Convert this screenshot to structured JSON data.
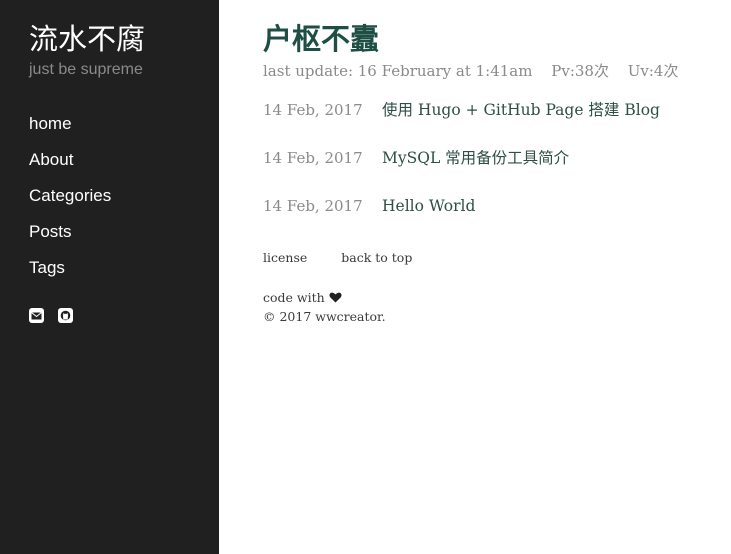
{
  "sidebar": {
    "title": "流水不腐",
    "subtitle": "just be supreme",
    "nav": [
      {
        "label": "home"
      },
      {
        "label": "About"
      },
      {
        "label": "Categories"
      },
      {
        "label": "Posts"
      },
      {
        "label": "Tags"
      }
    ],
    "social": [
      {
        "icon": "email-icon"
      },
      {
        "icon": "github-icon"
      }
    ]
  },
  "main": {
    "title": "户枢不蠹",
    "meta": {
      "last_update": "last update: 16 February at 1:41am",
      "pv": "Pv:38次",
      "uv": "Uv:4次"
    },
    "posts": [
      {
        "date": "14 Feb, 2017",
        "title": "使用 Hugo + GitHub Page 搭建 Blog"
      },
      {
        "date": "14 Feb, 2017",
        "title": "MySQL 常用备份工具简介"
      },
      {
        "date": "14 Feb, 2017",
        "title": "Hello World"
      }
    ],
    "footer": {
      "license": "license",
      "back_to_top": "back to top",
      "code_with": "code with",
      "copyright": "© 2017 wwcreator."
    }
  }
}
